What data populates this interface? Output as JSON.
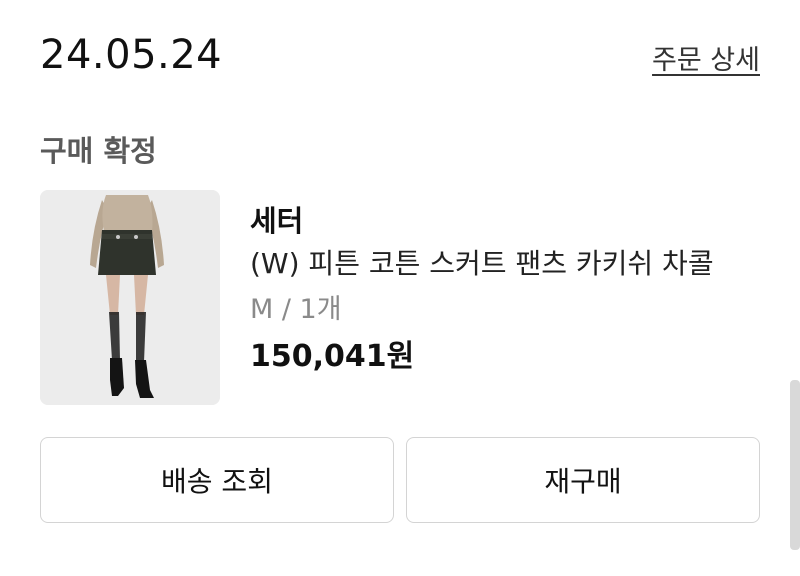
{
  "order": {
    "date": "24.05.24",
    "detail_link": "주문 상세",
    "status": "구매 확정"
  },
  "product": {
    "brand": "세터",
    "name": "(W) 피튼 코튼 스커트 팬츠 카키쉬 차콜",
    "option": "M / 1개",
    "price": "150,041원"
  },
  "actions": {
    "track_label": "배송 조회",
    "reorder_label": "재구매"
  },
  "colors": {
    "text": "#111111",
    "muted": "#8a8a8a",
    "border": "#d4d4d4"
  }
}
